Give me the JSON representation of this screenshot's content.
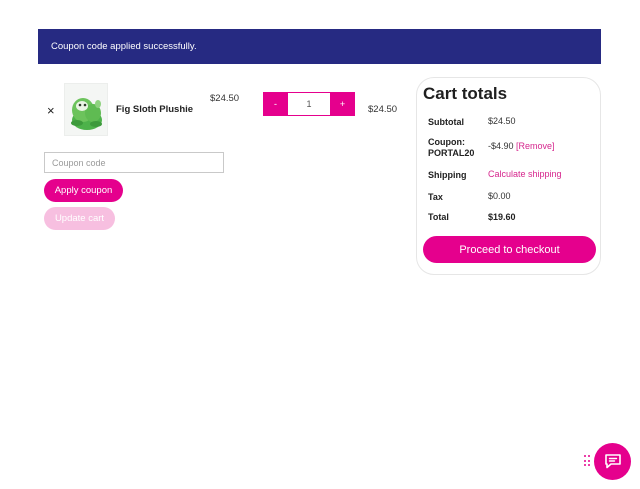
{
  "notice": {
    "message": "Coupon code applied successfully."
  },
  "cart": {
    "item": {
      "remove_symbol": "×",
      "name": "Fig Sloth Plushie",
      "price": "$24.50",
      "quantity": "1",
      "decrement_label": "-",
      "increment_label": "+",
      "subtotal": "$24.50"
    },
    "coupon": {
      "placeholder": "Coupon code"
    },
    "apply_coupon_label": "Apply coupon",
    "update_cart_label": "Update cart"
  },
  "totals": {
    "title": "Cart totals",
    "rows": {
      "subtotal": {
        "label": "Subtotal",
        "value": "$24.50"
      },
      "coupon": {
        "label_line1": "Coupon:",
        "label_line2": "PORTAL20",
        "value": "-$4.90",
        "remove_label": "[Remove]"
      },
      "shipping": {
        "label": "Shipping",
        "value": "Calculate shipping"
      },
      "tax": {
        "label": "Tax",
        "value": "$0.00"
      },
      "total": {
        "label": "Total",
        "value": "$19.60"
      }
    },
    "checkout_label": "Proceed to checkout"
  },
  "colors": {
    "notice_bg": "#262a82",
    "accent": "#e5008d",
    "accent_disabled": "#f7bfe0",
    "link": "#d6268d"
  },
  "icons": {
    "chat": "chat-bubble-icon",
    "drag": "drag-handle-icon",
    "product": "sloth-plush-image"
  }
}
